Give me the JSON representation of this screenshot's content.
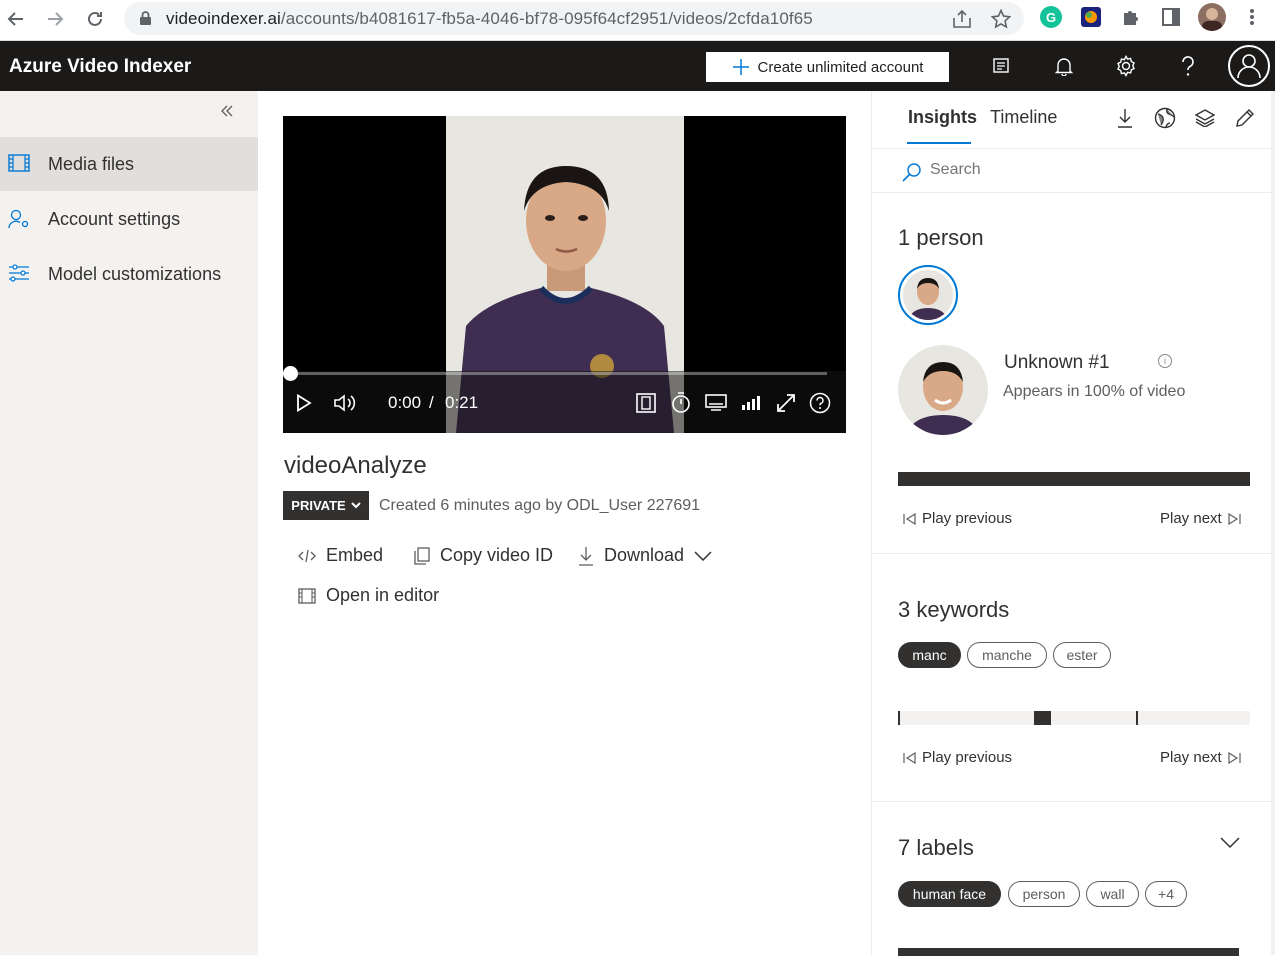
{
  "browser": {
    "url_host": "videoindexer.ai",
    "url_path": "/accounts/b4081617-fb5a-4046-bf78-095f64cf2951/videos/2cfda10f65"
  },
  "header": {
    "title": "Azure Video Indexer",
    "create_label": "Create unlimited account"
  },
  "sidebar": {
    "items": [
      {
        "label": "Media files",
        "icon": "film-icon"
      },
      {
        "label": "Account settings",
        "icon": "user-settings-icon"
      },
      {
        "label": "Model customizations",
        "icon": "sliders-icon"
      }
    ]
  },
  "player": {
    "current_time": "0:00",
    "separator": "/",
    "duration": "0:21",
    "progress": 0
  },
  "video": {
    "title": "videoAnalyze",
    "privacy": "PRIVATE",
    "created": "Created 6 minutes ago by ODL_User 227691",
    "actions": {
      "embed": "Embed",
      "copy_id": "Copy video ID",
      "download": "Download",
      "open_editor": "Open in editor"
    }
  },
  "insights": {
    "tabs": [
      "Insights",
      "Timeline"
    ],
    "search_placeholder": "Search",
    "people": {
      "title": "1 person",
      "name": "Unknown #1",
      "appears": "Appears in 100% of video",
      "play_previous": "Play previous",
      "play_next": "Play next"
    },
    "keywords": {
      "title": "3 keywords",
      "items": [
        "manc",
        "manche",
        "ester"
      ],
      "play_previous": "Play previous",
      "play_next": "Play next"
    },
    "labels": {
      "title": "7 labels",
      "items": [
        "human face",
        "person",
        "wall",
        "+4"
      ]
    }
  },
  "colors": {
    "header_bg": "#1b1a19",
    "accent": "#0078d4",
    "sidebar_bg": "#f3f2f1"
  }
}
